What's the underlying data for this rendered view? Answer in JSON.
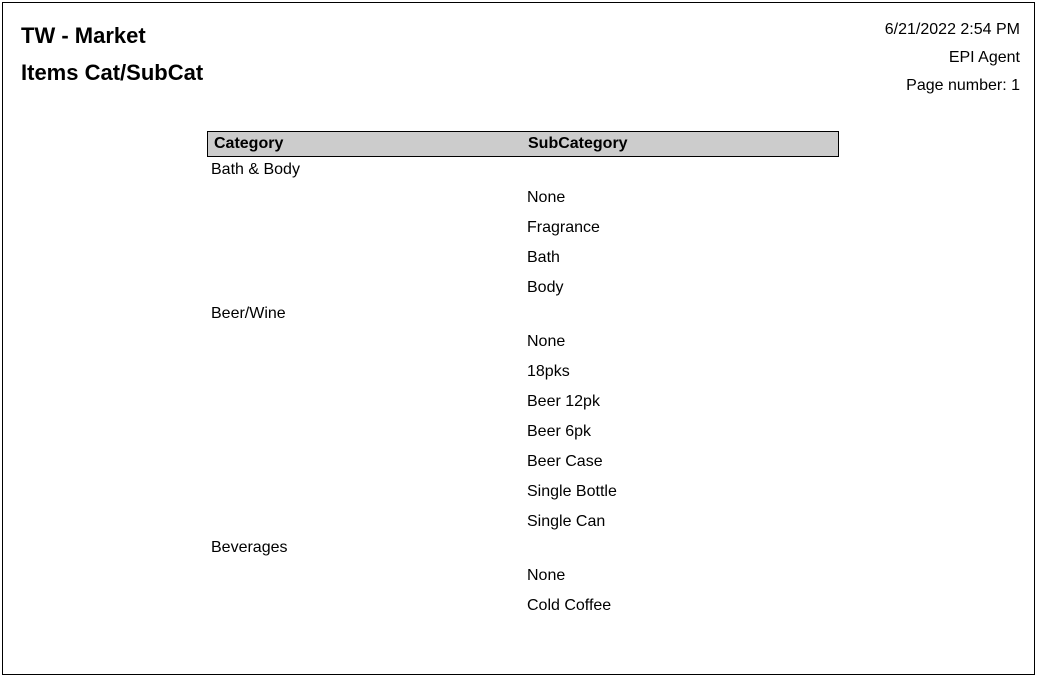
{
  "header": {
    "title": "TW - Market",
    "subtitle": "Items Cat/SubCat",
    "datetime": "6/21/2022 2:54 PM",
    "agent": "EPI Agent",
    "page_label": "Page number: 1"
  },
  "columns": {
    "category": "Category",
    "subcategory": "SubCategory"
  },
  "rows": [
    {
      "category": "Bath & Body",
      "sub": ""
    },
    {
      "category": "",
      "sub": "None"
    },
    {
      "category": "",
      "sub": "Fragrance"
    },
    {
      "category": "",
      "sub": "Bath"
    },
    {
      "category": "",
      "sub": "Body"
    },
    {
      "category": "Beer/Wine",
      "sub": ""
    },
    {
      "category": "",
      "sub": "None"
    },
    {
      "category": "",
      "sub": "18pks"
    },
    {
      "category": "",
      "sub": "Beer 12pk"
    },
    {
      "category": "",
      "sub": "Beer 6pk"
    },
    {
      "category": "",
      "sub": "Beer Case"
    },
    {
      "category": "",
      "sub": "Single Bottle"
    },
    {
      "category": "",
      "sub": "Single Can"
    },
    {
      "category": "Beverages",
      "sub": ""
    },
    {
      "category": "",
      "sub": "None"
    },
    {
      "category": "",
      "sub": "Cold Coffee"
    }
  ]
}
